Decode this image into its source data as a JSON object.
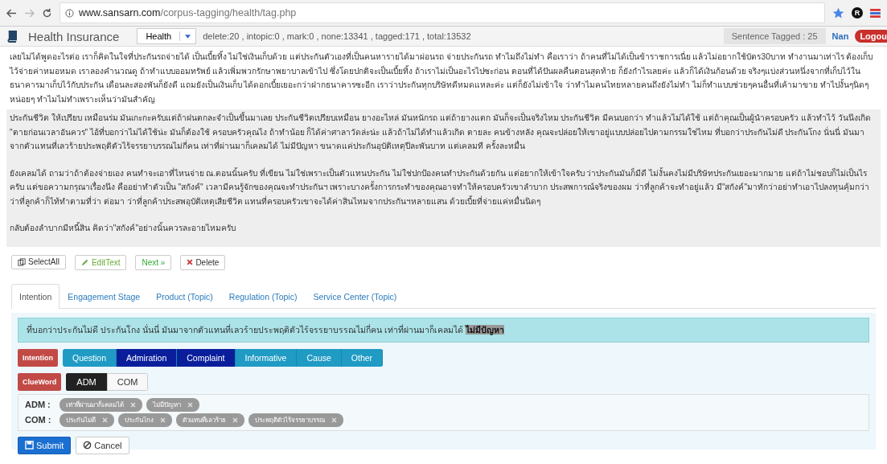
{
  "browser": {
    "url_host": "www.sansarn.com",
    "url_path": "/corpus-tagging/health/tag.php",
    "avatar": "R"
  },
  "app_bar": {
    "title": "Health Insurance",
    "category": "Health",
    "stats": "delete:20 , intopic:0 , mark:0 , none:13341 , tagged:171 , total:13532",
    "sentence_tagged": "Sentence Tagged : 25",
    "user": "Nan",
    "logout": "Logou"
  },
  "paragraphs": [
    {
      "text": "เลยไม่ได้พูดอะไรต่อ เราก็คิดในใจที่ประกันรถจ่ายได้ เป็นเบี้ยทิ้ง ไม่ใช่เงินเก็บด้วย แต่ประกันตัวเองที่เป็นคนหารายได้มาผ่อนรถ จ่ายประกันรถ ทำไมถึงไม่ทำ คือเราว่า ถ้าคนที่ไม่ได้เป็นข้าราชการเนี่ย แล้วไม่อยากใช้บัตร30บาท ทำงานมาเท่าไร ต้องเก็บไว้จ่ายค่าหมอหมด เราลองคำนวณดู ถ้าทำแบบออมทรัพย์ แล้วเพิ่มพวกรักษาพยาบาลเข้าไป ซึ่งโดยปกติจะเป็นเบี้ยทิ้ง ถ้าเราไม่เป็นอะไรไปซะก่อน ตอนที่ได้ปันผลคืนตอนสุดท้าย ก็ยังกำไรเลยค่ะ แล้วก็ได้เงินก้อนด้วย จริงๆแบ่งส่วนหนึ่งจากที่เก็บไว้ในธนาคารมาเก็บไว้กับประกัน เดือนละสองพันก็ยังดี แถมยังเป็นเงินเก็บ ได้ดอกเบี้ยเยอะกว่าฝากธนาคารซะอีก เราว่าประกันทุกบริษัทดีหมดแหละค่ะ แต่ก็ยังไม่เข้าใจ ว่าทำไมคนไทยหลายคนถึงยังไม่ทำ ไม่ก็ทำแบบช่วยๆคนอื่นที่เค้ามาขาย ทำไปงั้นๆนิดๆหน่อยๆ ทำไมไม่ทำเพราะเห็นว่ามันสำคัญ",
      "selected": false
    },
    {
      "text": "ประกันชีวิต ให้เปรียบ เหมือนร่ม มันเกะกะครับแต่ถ้าฝนตกละจำเป็นขึ้นมาเลย ประกันชีวิตเปรียบเหมือน ยางอะไหล่ มันหนักรถ แต่ถ้ายางแตก มันก็จะเป็นจริงไหม ประกันชีวิต มีคนบอกว่า ทำแล้วไม่ได้ใช้ แต่ถ้าคุณเป็นผู้นำครอบครัว แล้วทำไว้ วันนึงเกิด \"ตายก่อนเวลาอันควร\" ไอ้ที่บอกว่าไม่ได้ใช้น่ะ มันก็ต้องใช้ ครอบครัวคุณไง ถ้าทำน้อย ก็ได้ค่าศาลาวัดล่ะน่ะ แล้วถ้าไม่ได้ทำแล้วเกิด ตายละ คนข้างหลัง คุณจะปล่อยให้เขาอยู่แบบปล่อยไปตามกรรมใช่ไหม ที่บอกว่าประกันไม่ดี ประกันโกง นั่นนี่ มันมาจากตัวแทนที่เลวร้ายประพฤติตัวไร้จรรยาบรรณไม่กี่คน เท่าที่ผ่านมาก็เคลมได้ ไม่มีปัญหา ขนาดแค่ประกันอุบัติเหตุปีละพันบาท แต่เคลมที ครั้งละหมื่น",
      "selected": true
    },
    {
      "text": "ยังเคลมได้ ถามว่าถ้าต้องจ่ายเอง คนทำจะเอาที่ไหนจ่าย ณ.ตอนนั้นครับ ที่เขียน ไม่ใช่เพราะเป็นตัวแทนประกัน ไม่ใช่ปกป้องคนทำประกันด้วยกัน แต่อยากให้เข้าใจครับ ว่าประกันมันก็มีดี ไม่งั้นคงไม่มีบริษัทประกันเยอะมากมาย แต่ถ้าไม่ชอบก็ไม่เป็นไรครับ แต่ขอความกรุณาเรื่องนึง คืออย่าทำตัวเป็น \"สกังค์\" เวลามีคนรู้จักของคุณจะทำประกันฯ เพราะบางครั้งการกระทำของคุณอาจทำให้ครอบครัวเขาลำบาก ประสพการณ์จริงของผม ว่าที่ลูกค้าจะทำอยู่แล้ว มี\"สกังค์\"มาทักว่าอย่าทำเอาไปลงทุนคุ้มกว่า ว่าที่ลูกค้าก็ไท้ทำตามที่ว่า ต่อมา ว่าที่ลูกค้าประสพอุบัติเหตุเสียชีวิต แทนที่ครอบครัวเขาจะได้ค่าสินไหมจากประกันฯหลายแสน ด้วยเบี้ยที่จ่ายแค่หมื่นนิดๆ",
      "selected": true
    },
    {
      "text": "กลับต้องลำบากมีหนี้สิน คิดว่า\"สกังค์\"อย่างนั้นควรละอายไหมครับ",
      "selected": true
    }
  ],
  "actions": [
    {
      "kind": "select",
      "label": "SelectAll"
    },
    {
      "kind": "edit",
      "label": "EditText"
    },
    {
      "kind": "next",
      "label": "Next »"
    },
    {
      "kind": "delete",
      "label": "Delete"
    }
  ],
  "tabs": [
    {
      "label": "Intention",
      "selected": true
    },
    {
      "label": "Engagement Stage",
      "selected": false
    },
    {
      "label": "Product (Topic)",
      "selected": false
    },
    {
      "label": "Regulation (Topic)",
      "selected": false
    },
    {
      "label": "Service Center (Topic)",
      "selected": false
    }
  ],
  "sentence": [
    {
      "text": "ที่บอกว่าประกันไม่ดี ประกันโกง นั่นนี่ มันมาจากตัวแทนที่เลวร้ายประพฤติตัวไร้จรรยาบรรณไม่กี่คน เท่าที่ผ่านมาก็เคลมได้ ",
      "highlighted": false
    },
    {
      "text": "ไม่มีปัญหา",
      "highlighted": true
    }
  ],
  "intention": {
    "label": "Intention",
    "options": [
      {
        "label": "Question",
        "selected": false
      },
      {
        "label": "Admiration",
        "selected": true
      },
      {
        "label": "Complaint",
        "selected": true
      },
      {
        "label": "Informative",
        "selected": false
      },
      {
        "label": "Cause",
        "selected": false
      },
      {
        "label": "Other",
        "selected": false
      }
    ]
  },
  "clueword": {
    "label": "ClueWord",
    "options": [
      {
        "label": "ADM",
        "selected": true
      },
      {
        "label": "COM",
        "selected": false
      }
    ]
  },
  "clue_groups": [
    {
      "label": "ADM :",
      "tags": [
        "เท่าที่ผ่านมาก็เคลมได้",
        "ไม่มีปัญหา"
      ]
    },
    {
      "label": "COM :",
      "tags": [
        "ประกันไม่ดี",
        "ประกันโกง",
        "ตัวแทนที่เลวร้าย",
        "ประพฤติตัวไร้จรรยาบรรณ"
      ]
    }
  ],
  "form_buttons": [
    {
      "kind": "submit",
      "label": "Submit"
    },
    {
      "kind": "cancel",
      "label": "Cancel"
    }
  ]
}
